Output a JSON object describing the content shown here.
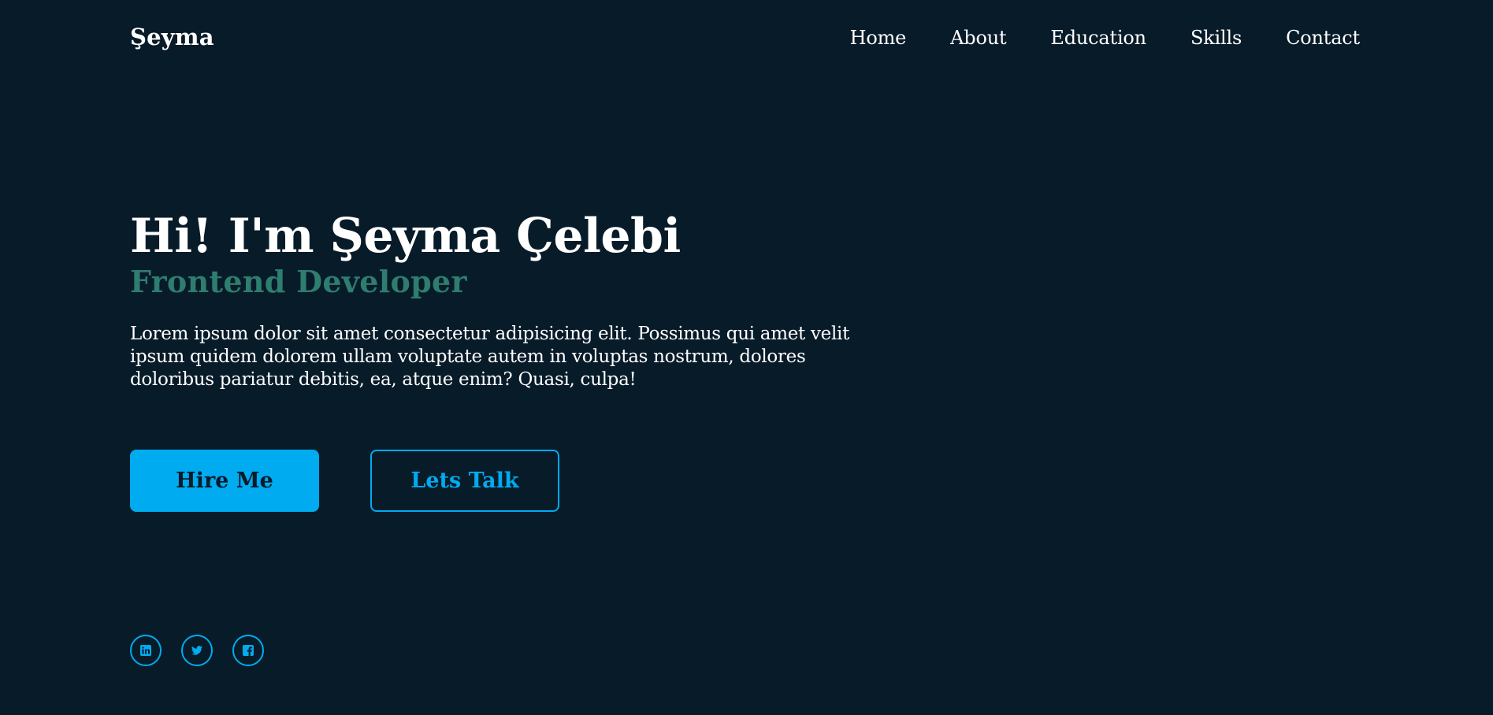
{
  "header": {
    "logo": "Şeyma",
    "nav": [
      "Home",
      "About",
      "Education",
      "Skills",
      "Contact"
    ]
  },
  "hero": {
    "title": "Hi! I'm Şeyma Çelebi",
    "subtitle": "Frontend Developer",
    "description": "Lorem ipsum dolor sit amet consectetur adipisicing elit. Possimus qui amet velit ipsum quidem dolorem ullam voluptate autem in voluptas nostrum, dolores doloribus pariatur debitis, ea, atque enim? Quasi, culpa!"
  },
  "buttons": {
    "primary": "Hire Me",
    "secondary": "Lets Talk"
  },
  "socials": [
    {
      "icon": "linkedin-icon"
    },
    {
      "icon": "twitter-icon"
    },
    {
      "icon": "facebook-icon"
    }
  ],
  "colors": {
    "background": "#081b29",
    "accent": "#00abf0",
    "subtitle": "#2e7d6f",
    "text": "#ffffff"
  }
}
